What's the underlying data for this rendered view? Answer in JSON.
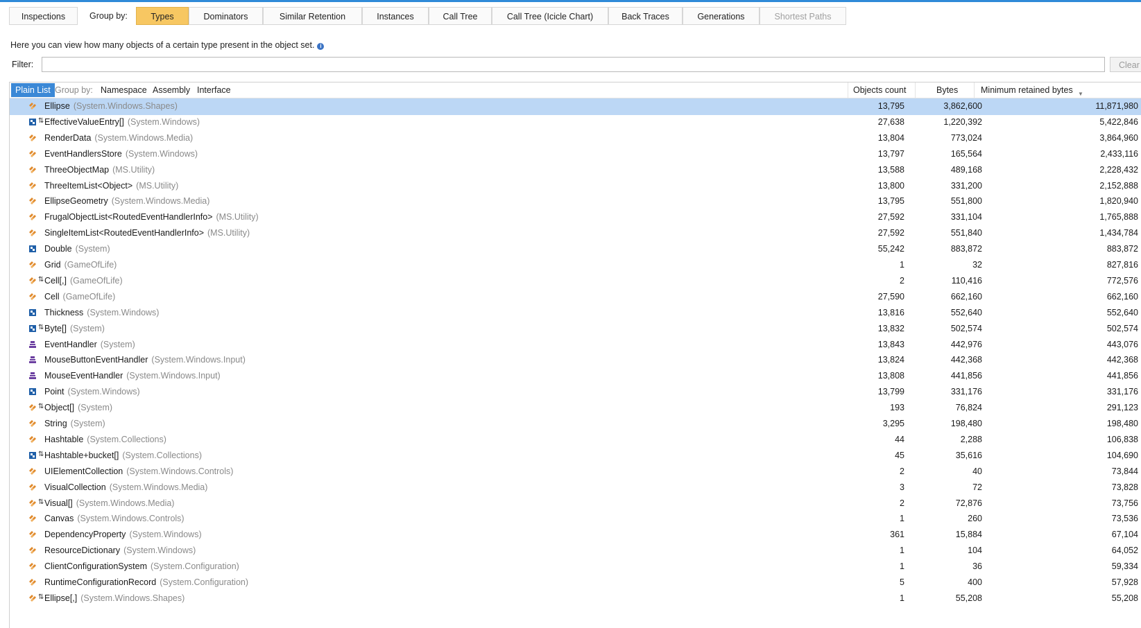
{
  "toolbar": {
    "inspections": "Inspections",
    "group_by_label": "Group by:",
    "tabs": [
      "Types",
      "Dominators",
      "Similar Retention",
      "Instances",
      "Call Tree",
      "Call Tree (Icicle Chart)",
      "Back Traces",
      "Generations",
      "Shortest Paths"
    ],
    "active_tab": "Types",
    "disabled_tab": "Shortest Paths"
  },
  "info_text": "Here you can view how many objects of a certain type present in the object set.",
  "filter": {
    "label": "Filter:",
    "value": "",
    "clear_label": "Clear"
  },
  "grid": {
    "plain_list_label": "Plain List",
    "group_by_label": "Group by:",
    "group_options": [
      "Namespace",
      "Assembly",
      "Interface"
    ],
    "columns": [
      "Objects count",
      "Bytes",
      "Minimum retained bytes"
    ],
    "rows": [
      {
        "name": "Ellipse",
        "ns": "(System.Windows.Shapes)",
        "icon": "class-icon",
        "count": "13,795",
        "bytes": "3,862,600",
        "retained": "11,871,980",
        "selected": true
      },
      {
        "name": "EffectiveValueEntry[]",
        "ns": "(System.Windows)",
        "icon": "struct-array-icon",
        "count": "27,638",
        "bytes": "1,220,392",
        "retained": "5,422,846"
      },
      {
        "name": "RenderData",
        "ns": "(System.Windows.Media)",
        "icon": "class-icon",
        "count": "13,804",
        "bytes": "773,024",
        "retained": "3,864,960"
      },
      {
        "name": "EventHandlersStore",
        "ns": "(System.Windows)",
        "icon": "class-icon",
        "count": "13,797",
        "bytes": "165,564",
        "retained": "2,433,116"
      },
      {
        "name": "ThreeObjectMap",
        "ns": "(MS.Utility)",
        "icon": "class-icon",
        "count": "13,588",
        "bytes": "489,168",
        "retained": "2,228,432"
      },
      {
        "name": "ThreeItemList<Object>",
        "ns": "(MS.Utility)",
        "icon": "class-icon",
        "count": "13,800",
        "bytes": "331,200",
        "retained": "2,152,888"
      },
      {
        "name": "EllipseGeometry",
        "ns": "(System.Windows.Media)",
        "icon": "class-icon",
        "count": "13,795",
        "bytes": "551,800",
        "retained": "1,820,940"
      },
      {
        "name": "FrugalObjectList<RoutedEventHandlerInfo>",
        "ns": "(MS.Utility)",
        "icon": "class-icon",
        "count": "27,592",
        "bytes": "331,104",
        "retained": "1,765,888"
      },
      {
        "name": "SingleItemList<RoutedEventHandlerInfo>",
        "ns": "(MS.Utility)",
        "icon": "class-icon",
        "count": "27,592",
        "bytes": "551,840",
        "retained": "1,434,784"
      },
      {
        "name": "Double",
        "ns": "(System)",
        "icon": "struct-icon",
        "count": "55,242",
        "bytes": "883,872",
        "retained": "883,872"
      },
      {
        "name": "Grid",
        "ns": "(GameOfLife)",
        "icon": "class-icon",
        "count": "1",
        "bytes": "32",
        "retained": "827,816"
      },
      {
        "name": "Cell[,]",
        "ns": "(GameOfLife)",
        "icon": "class-array-icon",
        "count": "2",
        "bytes": "110,416",
        "retained": "772,576"
      },
      {
        "name": "Cell",
        "ns": "(GameOfLife)",
        "icon": "class-icon",
        "count": "27,590",
        "bytes": "662,160",
        "retained": "662,160"
      },
      {
        "name": "Thickness",
        "ns": "(System.Windows)",
        "icon": "struct-icon",
        "count": "13,816",
        "bytes": "552,640",
        "retained": "552,640"
      },
      {
        "name": "Byte[]",
        "ns": "(System)",
        "icon": "struct-array-icon",
        "count": "13,832",
        "bytes": "502,574",
        "retained": "502,574"
      },
      {
        "name": "EventHandler",
        "ns": "(System)",
        "icon": "delegate-icon",
        "count": "13,843",
        "bytes": "442,976",
        "retained": "443,076"
      },
      {
        "name": "MouseButtonEventHandler",
        "ns": "(System.Windows.Input)",
        "icon": "delegate-icon",
        "count": "13,824",
        "bytes": "442,368",
        "retained": "442,368"
      },
      {
        "name": "MouseEventHandler",
        "ns": "(System.Windows.Input)",
        "icon": "delegate-icon",
        "count": "13,808",
        "bytes": "441,856",
        "retained": "441,856"
      },
      {
        "name": "Point",
        "ns": "(System.Windows)",
        "icon": "struct-icon",
        "count": "13,799",
        "bytes": "331,176",
        "retained": "331,176"
      },
      {
        "name": "Object[]",
        "ns": "(System)",
        "icon": "class-array-icon",
        "count": "193",
        "bytes": "76,824",
        "retained": "291,123"
      },
      {
        "name": "String",
        "ns": "(System)",
        "icon": "class-icon",
        "count": "3,295",
        "bytes": "198,480",
        "retained": "198,480"
      },
      {
        "name": "Hashtable",
        "ns": "(System.Collections)",
        "icon": "class-icon",
        "count": "44",
        "bytes": "2,288",
        "retained": "106,838"
      },
      {
        "name": "Hashtable+bucket[]",
        "ns": "(System.Collections)",
        "icon": "struct-array-icon",
        "count": "45",
        "bytes": "35,616",
        "retained": "104,690"
      },
      {
        "name": "UIElementCollection",
        "ns": "(System.Windows.Controls)",
        "icon": "class-icon",
        "count": "2",
        "bytes": "40",
        "retained": "73,844"
      },
      {
        "name": "VisualCollection",
        "ns": "(System.Windows.Media)",
        "icon": "class-icon",
        "count": "3",
        "bytes": "72",
        "retained": "73,828"
      },
      {
        "name": "Visual[]",
        "ns": "(System.Windows.Media)",
        "icon": "class-array-icon",
        "count": "2",
        "bytes": "72,876",
        "retained": "73,756"
      },
      {
        "name": "Canvas",
        "ns": "(System.Windows.Controls)",
        "icon": "class-icon",
        "count": "1",
        "bytes": "260",
        "retained": "73,536"
      },
      {
        "name": "DependencyProperty",
        "ns": "(System.Windows)",
        "icon": "class-icon",
        "count": "361",
        "bytes": "15,884",
        "retained": "67,104"
      },
      {
        "name": "ResourceDictionary",
        "ns": "(System.Windows)",
        "icon": "class-icon",
        "count": "1",
        "bytes": "104",
        "retained": "64,052"
      },
      {
        "name": "ClientConfigurationSystem",
        "ns": "(System.Configuration)",
        "icon": "class-icon",
        "count": "1",
        "bytes": "36",
        "retained": "59,334"
      },
      {
        "name": "RuntimeConfigurationRecord",
        "ns": "(System.Configuration)",
        "icon": "class-icon",
        "count": "5",
        "bytes": "400",
        "retained": "57,928"
      },
      {
        "name": "Ellipse[,]",
        "ns": "(System.Windows.Shapes)",
        "icon": "class-array-icon",
        "count": "1",
        "bytes": "55,208",
        "retained": "55,208"
      }
    ]
  },
  "colors": {
    "accent": "#3b88d6",
    "active_tab": "#f7c762",
    "selected_row": "#bcd7f5",
    "class_icon": "#e08a2c",
    "struct_icon": "#1f5fa8",
    "delegate_icon": "#6b3fa0"
  }
}
